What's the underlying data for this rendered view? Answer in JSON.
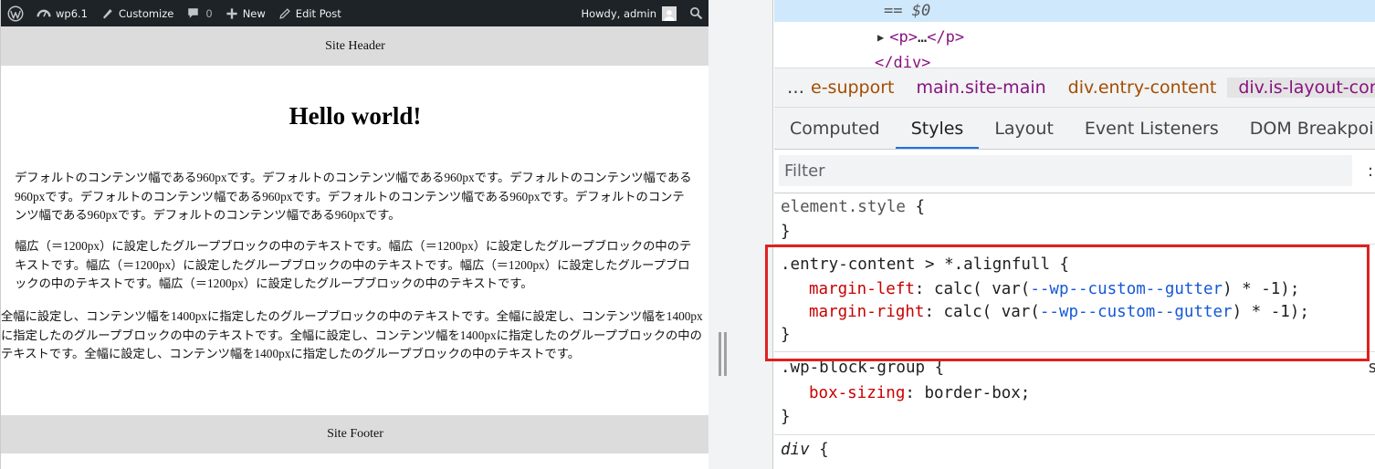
{
  "admin_bar": {
    "site_name": "wp6.1",
    "customize": "Customize",
    "comments_count": "0",
    "new": "New",
    "edit_post": "Edit Post",
    "howdy": "Howdy, admin"
  },
  "site": {
    "header": "Site Header",
    "title": "Hello world!",
    "para1": "デフォルトのコンテンツ幅である960pxです。デフォルトのコンテンツ幅である960pxです。デフォルトのコンテンツ幅である960pxです。デフォルトのコンテンツ幅である960pxです。デフォルトのコンテンツ幅である960pxです。デフォルトのコンテンツ幅である960pxです。デフォルトのコンテンツ幅である960pxです。",
    "para2": "幅広（＝1200px）に設定したグループブロックの中のテキストです。幅広（＝1200px）に設定したグループブロックの中のテキストです。幅広（＝1200px）に設定したグループブロックの中のテキストです。幅広（＝1200px）に設定したグループブロックの中のテキストです。幅広（＝1200px）に設定したグループブロックの中のテキストです。",
    "para3": "全幅に設定し、コンテンツ幅を1400pxに指定したのグループブロックの中のテキストです。全幅に設定し、コンテンツ幅を1400pxに指定したのグループブロックの中のテキストです。全幅に設定し、コンテンツ幅を1400pxに指定したのグループブロックの中のテキストです。全幅に設定し、コンテンツ幅を1400pxに指定したのグループブロックの中のテキストです。",
    "footer": "Site Footer"
  },
  "devtools": {
    "dom": {
      "selected_marker": "== $0",
      "p_open": "<p>",
      "p_ellipsis": "…",
      "p_close": "</p>",
      "div_close": "</div>"
    },
    "breadcrumb": {
      "more": "…",
      "items": [
        "e-support",
        "main.site-main",
        "div.entry-content",
        "div.is-layout-cor"
      ]
    },
    "tabs": [
      "Computed",
      "Styles",
      "Layout",
      "Event Listeners",
      "DOM Breakpoint"
    ],
    "active_tab": "Styles",
    "filter_placeholder": "Filter",
    "filter_more": ":",
    "rules": {
      "element_style": {
        "selector": "element.style",
        "open": " {",
        "close": "}"
      },
      "alignfull": {
        "selector": ".entry-content > *.alignfull",
        "open": " {",
        "decl1_prop": "margin-left",
        "decl1_pre": "calc( var(",
        "decl1_var": "--wp--custom--gutter",
        "decl1_post": ") * -1);",
        "decl2_prop": "margin-right",
        "decl2_pre": "calc( var(",
        "decl2_var": "--wp--custom--gutter",
        "decl2_post": ") * -1);",
        "close": "}"
      },
      "wp_block_group": {
        "selector": ".wp-block-group",
        "open": " {",
        "decl_prop": "box-sizing",
        "decl_value": "border-box;",
        "close": "}",
        "source": "s"
      },
      "div": {
        "selector": "div",
        "open": " {"
      }
    },
    "colon": ": "
  },
  "colors": {
    "admin_bar": "#1d2327",
    "header_footer_bg": "#dcdcdc",
    "highlight_border": "#e02020",
    "active_tab_underline": "#1a73e8",
    "css_property": "#c80000",
    "css_variable": "#1558d6",
    "dom_tag": "#881280"
  }
}
